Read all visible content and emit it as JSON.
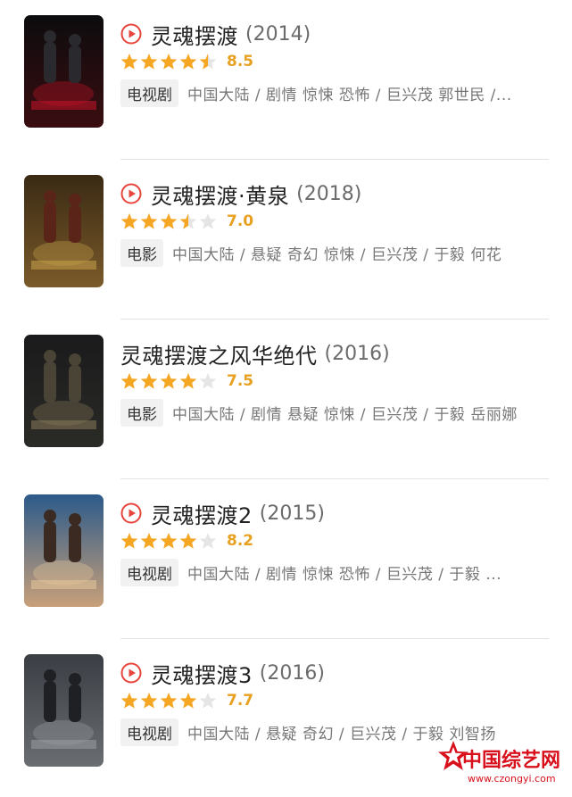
{
  "items": [
    {
      "title": "灵魂摆渡",
      "year": "(2014)",
      "rating": 8.5,
      "stars": 4.5,
      "score": "8.5",
      "type": "电视剧",
      "meta": "中国大陆 / 剧情 惊悚 恐怖 / 巨兴茂 郭世民 /...",
      "has_play": true,
      "poster_theme": "red"
    },
    {
      "title": "灵魂摆渡·黄泉",
      "year": "(2018)",
      "rating": 7.0,
      "stars": 3.5,
      "score": "7.0",
      "type": "电影",
      "meta": "中国大陆 / 悬疑 奇幻 惊悚 / 巨兴茂 / 于毅 何花",
      "has_play": true,
      "poster_theme": "gold"
    },
    {
      "title": "灵魂摆渡之风华绝代",
      "year": "(2016)",
      "rating": 7.5,
      "stars": 4,
      "score": "7.5",
      "type": "电影",
      "meta": "中国大陆 / 剧情 悬疑 惊悚 / 巨兴茂 / 于毅 岳丽娜",
      "has_play": false,
      "poster_theme": "dark"
    },
    {
      "title": "灵魂摆渡2",
      "year": "(2015)",
      "rating": 8.2,
      "stars": 4,
      "score": "8.2",
      "type": "电视剧",
      "meta": "中国大陆 / 剧情 惊悚 恐怖 / 巨兴茂 / 于毅 ...",
      "has_play": true,
      "poster_theme": "sky"
    },
    {
      "title": "灵魂摆渡3",
      "year": "(2016)",
      "rating": 7.7,
      "stars": 4,
      "score": "7.7",
      "type": "电视剧",
      "meta": "中国大陆 / 悬疑 奇幻 / 巨兴茂 / 于毅 刘智扬",
      "has_play": true,
      "poster_theme": "grey"
    }
  ],
  "colors": {
    "star_on": "#f5a623",
    "star_off": "#e5e5e5",
    "play": "#e8453c",
    "score": "#e8a020"
  },
  "watermark": {
    "text": "中国综艺网",
    "url": "www.czongyi.com"
  }
}
